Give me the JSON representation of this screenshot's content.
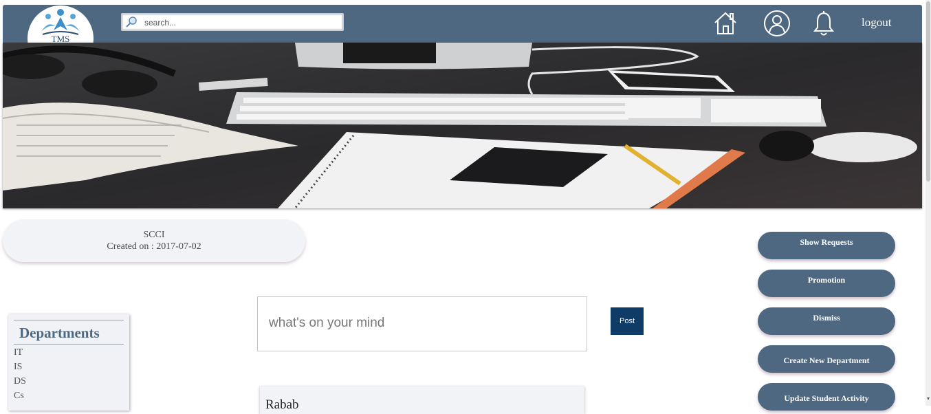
{
  "header": {
    "logo_text": "TMS",
    "search_placeholder": "search...",
    "icons": [
      "home-icon",
      "profile-icon",
      "bell-icon"
    ],
    "logout_label": "logout"
  },
  "group": {
    "name": "SCCI",
    "created": "Created on : 2017-07-02"
  },
  "departments": {
    "title": "Departments",
    "items": [
      "IT",
      "IS",
      "DS",
      "Cs"
    ]
  },
  "composer": {
    "placeholder": "what's on your mind",
    "post_label": "Post"
  },
  "posts": [
    {
      "author": "Rabab"
    }
  ],
  "actions": [
    "Show Requests",
    "Promotion",
    "Dismiss",
    "Create New Department",
    "Update Student Activity"
  ],
  "colors": {
    "navbar": "#4e6882",
    "post_button": "#0e3c66",
    "card": "#f2f3f6"
  }
}
